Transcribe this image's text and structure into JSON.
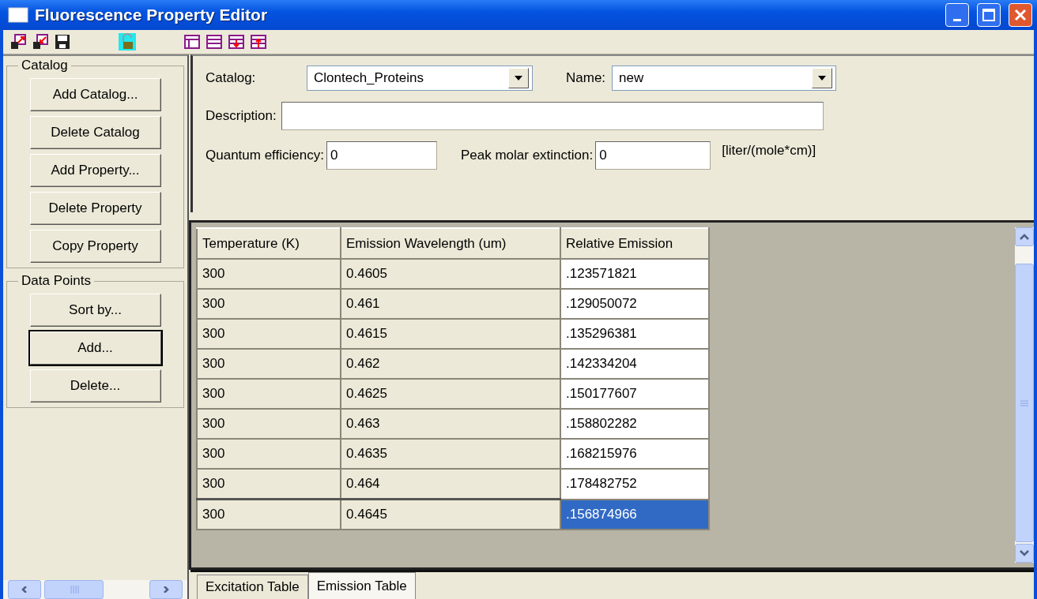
{
  "window": {
    "title": "Fluorescence Property Editor"
  },
  "catalog_group": {
    "title": "Catalog",
    "buttons": [
      {
        "label": "Add Catalog...",
        "focused": false
      },
      {
        "label": "Delete Catalog",
        "focused": false
      },
      {
        "label": "Add  Property...",
        "focused": false
      },
      {
        "label": "Delete Property",
        "focused": false
      },
      {
        "label": "Copy Property",
        "focused": false
      }
    ]
  },
  "data_points_group": {
    "title": "Data Points",
    "buttons": [
      {
        "label": "Sort by...",
        "focused": false
      },
      {
        "label": "Add...",
        "focused": true
      },
      {
        "label": "Delete...",
        "focused": false
      }
    ]
  },
  "form": {
    "catalog": {
      "label": "Catalog:",
      "value": "Clontech_Proteins"
    },
    "name": {
      "label": "Name:",
      "value": "new"
    },
    "description": {
      "label": "Description:"
    },
    "quantum_efficiency": {
      "label": "Quantum efficiency:",
      "value": "0"
    },
    "peak_molar_extinction": {
      "label": "Peak molar extinction:",
      "value": "0",
      "unit": "[liter/(mole*cm)]"
    }
  },
  "table": {
    "columns": [
      "Temperature (K)",
      "Emission Wavelength (um)",
      "Relative Emission"
    ],
    "rows": [
      {
        "cells": [
          "300",
          "0.4605",
          ".123571821"
        ],
        "selected": false
      },
      {
        "cells": [
          "300",
          "0.461",
          ".129050072"
        ],
        "selected": false
      },
      {
        "cells": [
          "300",
          "0.4615",
          ".135296381"
        ],
        "selected": false
      },
      {
        "cells": [
          "300",
          "0.462",
          ".142334204"
        ],
        "selected": false
      },
      {
        "cells": [
          "300",
          "0.4625",
          ".150177607"
        ],
        "selected": false
      },
      {
        "cells": [
          "300",
          "0.463",
          ".158802282"
        ],
        "selected": false
      },
      {
        "cells": [
          "300",
          "0.4635",
          ".168215976"
        ],
        "selected": false
      },
      {
        "cells": [
          "300",
          "0.464",
          ".178482752"
        ],
        "selected": false
      },
      {
        "cells": [
          "300",
          "0.4645",
          ".156874966"
        ],
        "selected": true
      }
    ]
  },
  "tabs": [
    {
      "label": "Excitation Table",
      "selected": false
    },
    {
      "label": "Emission Table",
      "selected": true
    }
  ]
}
